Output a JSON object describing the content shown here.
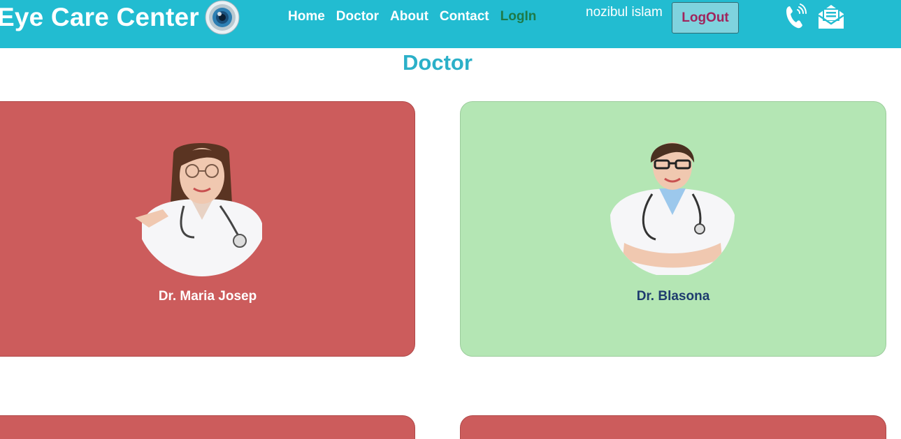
{
  "header": {
    "brand": "Eye Care Center",
    "brand_logo_icon": "eye-logo-icon",
    "nav": [
      {
        "label": "Home"
      },
      {
        "label": "Doctor"
      },
      {
        "label": "About"
      },
      {
        "label": "Contact"
      },
      {
        "label": "LogIn"
      }
    ],
    "user_name": "nozibul islam",
    "logout_label": "LogOut",
    "phone_icon": "phone-icon",
    "mail_icon": "mail-icon"
  },
  "colors": {
    "header_bg": "#22bcd1",
    "title": "#2bb0c8",
    "card_red": "#cc5c5c",
    "card_green": "#b4e6b4",
    "login_link": "#1d7a47",
    "logout_text": "#a0245c"
  },
  "main": {
    "title": "Doctor",
    "doctors": [
      {
        "name": "Dr. Maria Josep",
        "card_color": "red"
      },
      {
        "name": "Dr. Blasona",
        "card_color": "green"
      },
      {
        "name": "",
        "card_color": "red"
      },
      {
        "name": "",
        "card_color": "red"
      }
    ]
  }
}
